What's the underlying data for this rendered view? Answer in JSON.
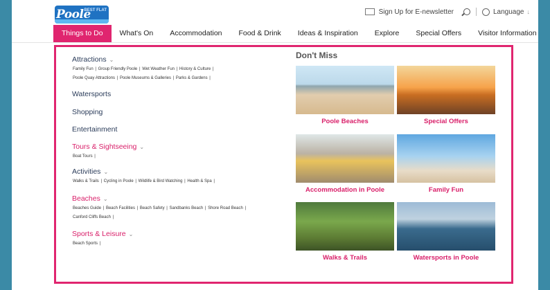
{
  "logo": {
    "word": "Poole",
    "tagline": "BEST FLAT"
  },
  "top": {
    "newsletter": "Sign Up for E-newsletter",
    "language": "Language"
  },
  "nav": {
    "items": [
      "Things to Do",
      "What's On",
      "Accommodation",
      "Food & Drink",
      "Ideas & Inspiration",
      "Explore",
      "Special Offers",
      "Visitor Information"
    ]
  },
  "menu": {
    "attractions": {
      "title": "Attractions",
      "row1": [
        "Family Fun",
        "Group Friendly Poole",
        "Wet Weather Fun",
        "History & Culture"
      ],
      "row2": [
        "Poole Quay Attractions",
        "Poole Museums & Galleries",
        "Parks & Gardens"
      ]
    },
    "watersports": "Watersports",
    "shopping": "Shopping",
    "entertainment": "Entertainment",
    "tours": {
      "title": "Tours & Sightseeing",
      "row1": [
        "Boat Tours"
      ]
    },
    "activities": {
      "title": "Activities",
      "row1": [
        "Walks & Trails",
        "Cycling in Poole",
        "Wildlife & Bird Watching",
        "Health & Spa"
      ]
    },
    "beaches": {
      "title": "Beaches",
      "row1": [
        "Beaches Guide",
        "Beach Facilities",
        "Beach Safety",
        "Sandbanks Beach",
        "Shore Road Beach"
      ],
      "row2": [
        "Canford Cliffs Beach"
      ]
    },
    "sports": {
      "title": "Sports & Leisure",
      "row1": [
        "Beach Sports"
      ]
    }
  },
  "dont_miss": {
    "title": "Don't Miss",
    "tiles": [
      "Poole Beaches",
      "Special Offers",
      "Accommodation in Poole",
      "Family Fun",
      "Walks & Trails",
      "Watersports in Poole"
    ]
  }
}
